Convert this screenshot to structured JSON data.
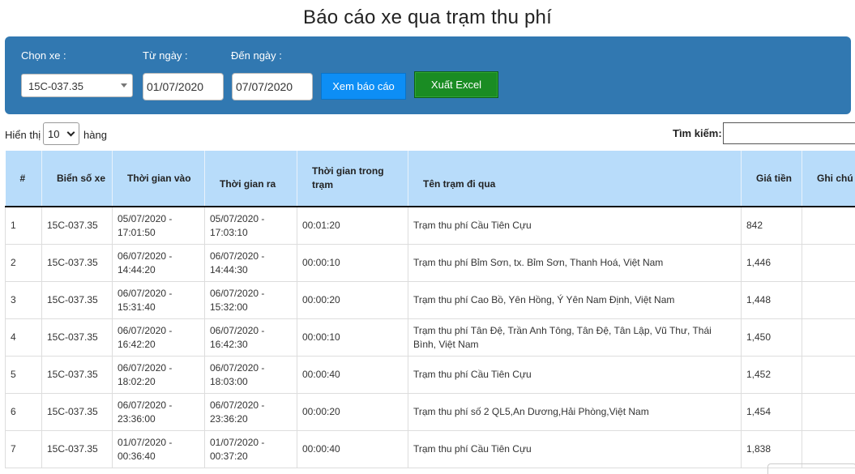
{
  "page_title": "Báo cáo xe qua trạm thu phí",
  "filters": {
    "vehicle_label": "Chọn xe :",
    "vehicle_value": "15C-037.35",
    "from_label": "Từ ngày :",
    "from_value": "01/07/2020",
    "to_label": "Đến ngày :",
    "to_value": "07/07/2020",
    "view_button": "Xem báo cáo",
    "excel_button": "Xuất Excel",
    "colors": {
      "panel": "#3178b1",
      "view_button": "#0d8ef5",
      "excel_button": "#1a8c23"
    }
  },
  "list_controls": {
    "show_label": "Hiển thị",
    "entries_value": "10",
    "entries_suffix": "hàng",
    "search_label": "Tìm kiếm:",
    "search_value": ""
  },
  "table": {
    "header_color": "#b8dcfa",
    "columns": [
      "#",
      "Biển số xe",
      "Thời gian vào",
      "Thời gian ra",
      "Thời gian trong trạm",
      "Tên trạm đi qua",
      "Giá tiền",
      "Ghi chú"
    ],
    "rows": [
      [
        "1",
        "15C-037.35",
        "05/07/2020 - 17:01:50",
        "05/07/2020 - 17:03:10",
        "00:01:20",
        "Trạm thu phí Cầu Tiên Cựu",
        "842",
        ""
      ],
      [
        "2",
        "15C-037.35",
        "06/07/2020 - 14:44:20",
        "06/07/2020 - 14:44:30",
        "00:00:10",
        "Trạm thu phí Bỉm Sơn, tx. Bỉm Sơn, Thanh Hoá, Việt Nam",
        "1,446",
        ""
      ],
      [
        "3",
        "15C-037.35",
        "06/07/2020 - 15:31:40",
        "06/07/2020 - 15:32:00",
        "00:00:20",
        "Trạm thu phí Cao Bồ, Yên Hồng, Ý Yên Nam Định, Việt Nam",
        "1,448",
        ""
      ],
      [
        "4",
        "15C-037.35",
        "06/07/2020 - 16:42:20",
        "06/07/2020 - 16:42:30",
        "00:00:10",
        "Trạm thu phí Tân Đệ, Trần Anh Tông, Tân Đệ, Tân Lập, Vũ Thư, Thái Bình, Việt Nam",
        "1,450",
        ""
      ],
      [
        "5",
        "15C-037.35",
        "06/07/2020 - 18:02:20",
        "06/07/2020 - 18:03:00",
        "00:00:40",
        "Trạm thu phí Cầu Tiên Cựu",
        "1,452",
        ""
      ],
      [
        "6",
        "15C-037.35",
        "06/07/2020 - 23:36:00",
        "06/07/2020 - 23:36:20",
        "00:00:20",
        "Trạm thu phí số 2 QL5,An Dương,Hải Phòng,Việt Nam",
        "1,454",
        ""
      ],
      [
        "7",
        "15C-037.35",
        "01/07/2020 - 00:36:40",
        "01/07/2020 - 00:37:20",
        "00:00:40",
        "Trạm thu phí Cầu Tiên Cựu",
        "1,838",
        ""
      ]
    ]
  }
}
